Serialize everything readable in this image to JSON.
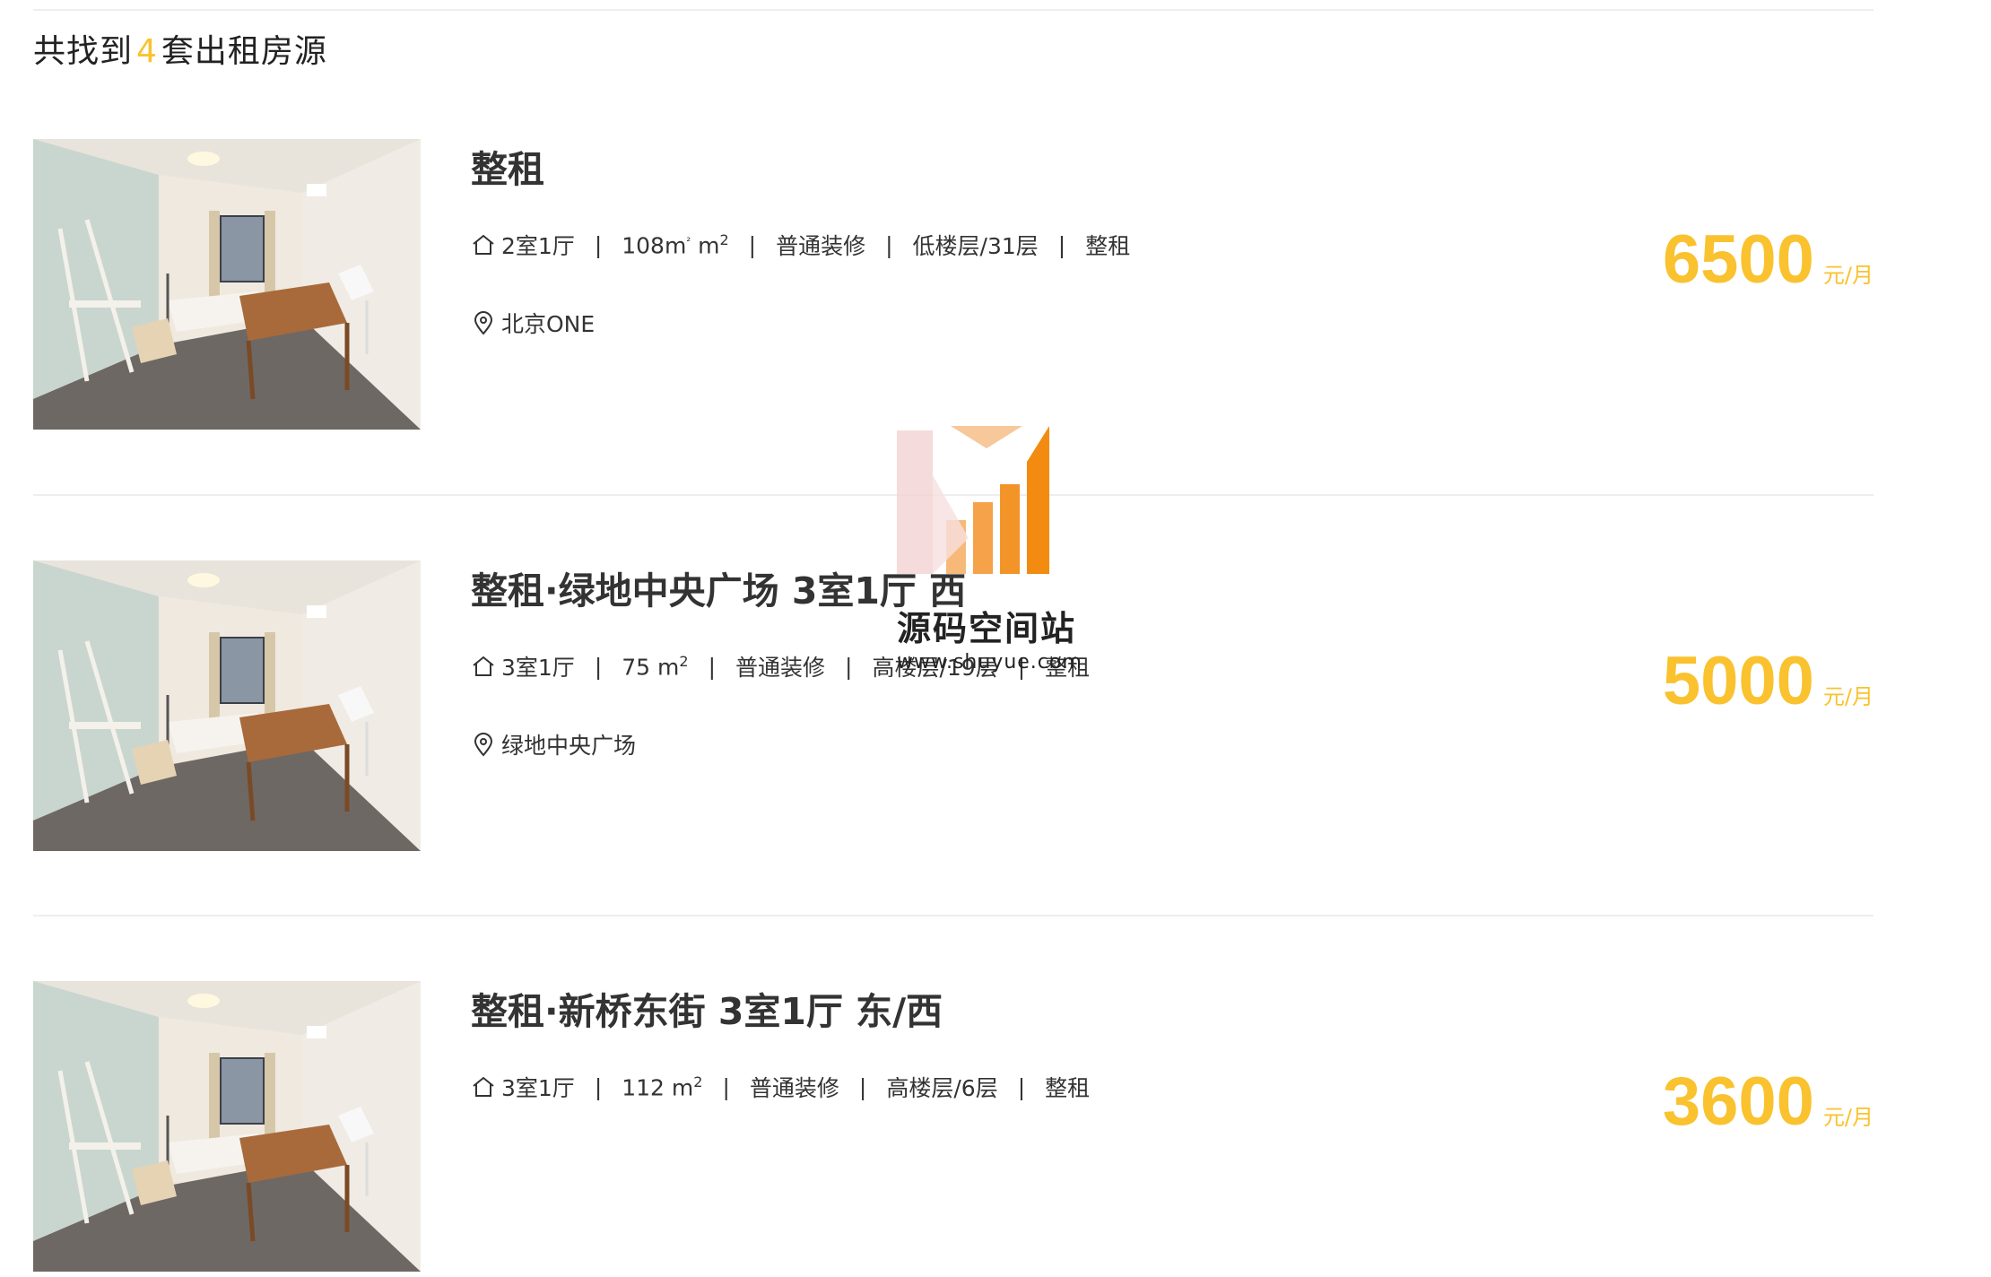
{
  "summary": {
    "prefix": "共找到",
    "count": "4",
    "suffix": "套出租房源"
  },
  "listings": [
    {
      "title": "整租",
      "layout": "2室1厅",
      "area_value": "108m",
      "area_extra": "m",
      "area_sup": "2",
      "area_sup_small": "²",
      "decoration": "普通装修",
      "floor": "低楼层/31层",
      "rent_type": "整租",
      "location": "北京ONE",
      "price": "6500",
      "unit": "元/月"
    },
    {
      "title": "整租·绿地中央广场 3室1厅 西",
      "layout": "3室1厅",
      "area_value": "75 m",
      "area_sup": "2",
      "decoration": "普通装修",
      "floor": "高楼层/19层",
      "rent_type": "整租",
      "location": "绿地中央广场",
      "price": "5000",
      "unit": "元/月"
    },
    {
      "title": "整租·新桥东街 3室1厅 东/西",
      "layout": "3室1厅",
      "area_value": "112 m",
      "area_sup": "2",
      "decoration": "普通装修",
      "floor": "高楼层/6层",
      "rent_type": "整租",
      "location": "",
      "price": "3600",
      "unit": "元/月"
    }
  ],
  "separator": "|",
  "watermark": {
    "name": "源码空间站",
    "url": "www.shuyue.com"
  },
  "icons": {
    "house": "house-icon",
    "location": "location-pin-icon",
    "photo": "room-photo"
  },
  "colors": {
    "accent": "#f9c22e",
    "text": "#333333",
    "divider": "#eeeeee"
  }
}
